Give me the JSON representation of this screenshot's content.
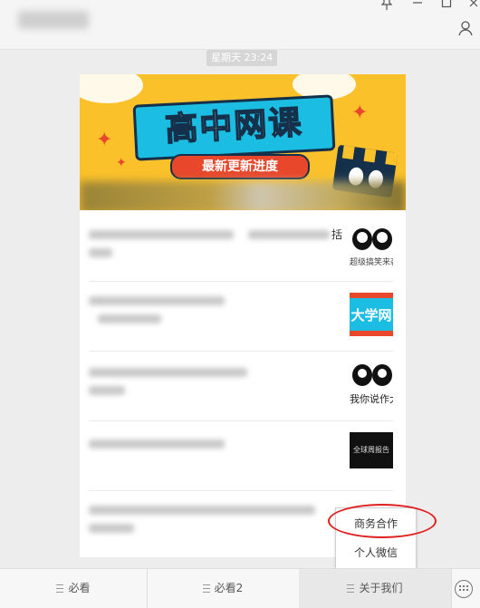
{
  "window": {
    "controls": {
      "pin_icon": "pin-icon",
      "minimize_icon": "minimize-icon",
      "maximize_icon": "maximize-icon",
      "close_icon": "close-icon",
      "profile_icon": "profile-icon"
    }
  },
  "chat": {
    "timestamp": "星期天 23:24"
  },
  "banner": {
    "title": "高中网课",
    "subtitle": "最新更新进度"
  },
  "articles": [
    {
      "tail_text": "括",
      "thumb_caption": "超级搞笑来袭"
    },
    {
      "tail_text": "",
      "thumb_caption": "大学网"
    },
    {
      "tail_text": "",
      "thumb_caption": "我你说作大"
    },
    {
      "tail_text": "",
      "thumb_caption": "全球周报告"
    }
  ],
  "popup_menu": {
    "items": [
      "商务合作",
      "个人微信"
    ]
  },
  "bottom_menu": {
    "items": [
      "必看",
      "必看2",
      "关于我们"
    ],
    "keyboard_icon": "keyboard-icon"
  },
  "colors": {
    "highlight": "#e02020",
    "banner_yellow": "#fbc12a",
    "banner_cyan": "#1bbde2",
    "banner_red": "#e8472b"
  }
}
